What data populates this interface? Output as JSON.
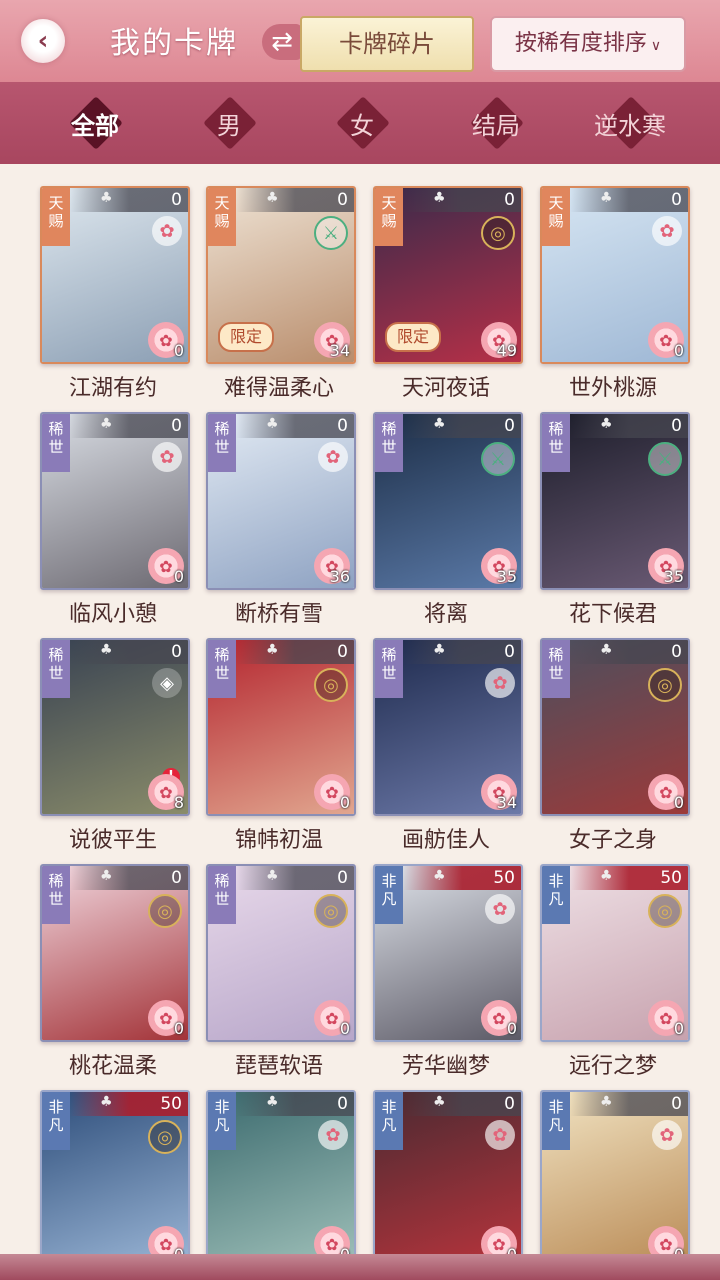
{
  "header": {
    "title": "我的卡牌",
    "fragments_label": "卡牌碎片",
    "sort_label": "按稀有度排序"
  },
  "filters": [
    {
      "label": "全部",
      "active": true
    },
    {
      "label": "男",
      "active": false
    },
    {
      "label": "女",
      "active": false
    },
    {
      "label": "结局",
      "active": false
    },
    {
      "label": "逆水寒",
      "active": false
    }
  ],
  "cards": [
    {
      "name": "江湖有约",
      "tier": "天赐",
      "count": "0",
      "emblem": "flower",
      "fragments": "0",
      "limited": false,
      "colors": [
        "#dfe8ef",
        "#8c9fb4"
      ]
    },
    {
      "name": "难得温柔心",
      "tier": "天赐",
      "count": "0",
      "emblem": "sword",
      "fragments": "34",
      "limited": true,
      "colors": [
        "#efe4d6",
        "#b98d6c"
      ]
    },
    {
      "name": "天河夜话",
      "tier": "天赐",
      "count": "0",
      "emblem": "coin",
      "fragments": "49",
      "limited": true,
      "colors": [
        "#3a2a4a",
        "#b73048"
      ]
    },
    {
      "name": "世外桃源",
      "tier": "天赐",
      "count": "0",
      "emblem": "flower",
      "fragments": "0",
      "limited": false,
      "colors": [
        "#d7e6f3",
        "#9fb8d5"
      ]
    },
    {
      "name": "临风小憩",
      "tier": "稀世",
      "count": "0",
      "emblem": "flower",
      "fragments": "0",
      "limited": false,
      "colors": [
        "#d9dde4",
        "#6d6a72"
      ]
    },
    {
      "name": "断桥有雪",
      "tier": "稀世",
      "count": "0",
      "emblem": "flower",
      "fragments": "36",
      "limited": false,
      "colors": [
        "#e3ebf4",
        "#8ea2c2"
      ]
    },
    {
      "name": "将离",
      "tier": "稀世",
      "count": "0",
      "emblem": "sword",
      "fragments": "35",
      "limited": false,
      "colors": [
        "#1c2d46",
        "#5b7aa8"
      ]
    },
    {
      "name": "花下候君",
      "tier": "稀世",
      "count": "0",
      "emblem": "sword",
      "fragments": "35",
      "limited": false,
      "colors": [
        "#1c1d2a",
        "#6a5a74"
      ]
    },
    {
      "name": "说彼平生",
      "tier": "稀世",
      "count": "0",
      "emblem": "fan",
      "fragments": "8",
      "limited": false,
      "alert": true,
      "colors": [
        "#384252",
        "#8a8c6a"
      ]
    },
    {
      "name": "锦帏初温",
      "tier": "稀世",
      "count": "0",
      "emblem": "coin",
      "fragments": "0",
      "limited": false,
      "colors": [
        "#b4252f",
        "#e1a68f"
      ]
    },
    {
      "name": "画舫佳人",
      "tier": "稀世",
      "count": "0",
      "emblem": "flower",
      "fragments": "34",
      "limited": false,
      "colors": [
        "#1e2a4d",
        "#6c79a8"
      ]
    },
    {
      "name": "女子之身",
      "tier": "稀世",
      "count": "0",
      "emblem": "coin",
      "fragments": "0",
      "limited": false,
      "colors": [
        "#4c4f5e",
        "#9c3a3a"
      ]
    },
    {
      "name": "桃花温柔",
      "tier": "稀世",
      "count": "0",
      "emblem": "coin",
      "fragments": "0",
      "limited": false,
      "colors": [
        "#f1d7df",
        "#a33338"
      ]
    },
    {
      "name": "琵琶软语",
      "tier": "稀世",
      "count": "0",
      "emblem": "coin",
      "fragments": "0",
      "limited": false,
      "colors": [
        "#e8d9ea",
        "#b7a6c9"
      ]
    },
    {
      "name": "芳华幽梦",
      "tier": "非凡",
      "count": "50",
      "emblem": "flower",
      "fragments": "0",
      "limited": false,
      "colors": [
        "#dfe3ea",
        "#5c5a66"
      ]
    },
    {
      "name": "远行之梦",
      "tier": "非凡",
      "count": "50",
      "emblem": "coin",
      "fragments": "0",
      "limited": false,
      "colors": [
        "#efe1e6",
        "#c7a2ae"
      ]
    },
    {
      "name": "",
      "tier": "非凡",
      "count": "50",
      "emblem": "coin",
      "fragments": "0",
      "limited": false,
      "colors": [
        "#2d4d7a",
        "#9bb6d6"
      ]
    },
    {
      "name": "",
      "tier": "非凡",
      "count": "0",
      "emblem": "flower",
      "fragments": "0",
      "limited": false,
      "colors": [
        "#3b6a6e",
        "#9fc0b9"
      ]
    },
    {
      "name": "",
      "tier": "非凡",
      "count": "0",
      "emblem": "flower",
      "fragments": "0",
      "limited": false,
      "colors": [
        "#4a2a32",
        "#b8343c"
      ]
    },
    {
      "name": "",
      "tier": "非凡",
      "count": "0",
      "emblem": "flower",
      "fragments": "0",
      "limited": false,
      "colors": [
        "#f1e3c2",
        "#b98a55"
      ]
    }
  ]
}
